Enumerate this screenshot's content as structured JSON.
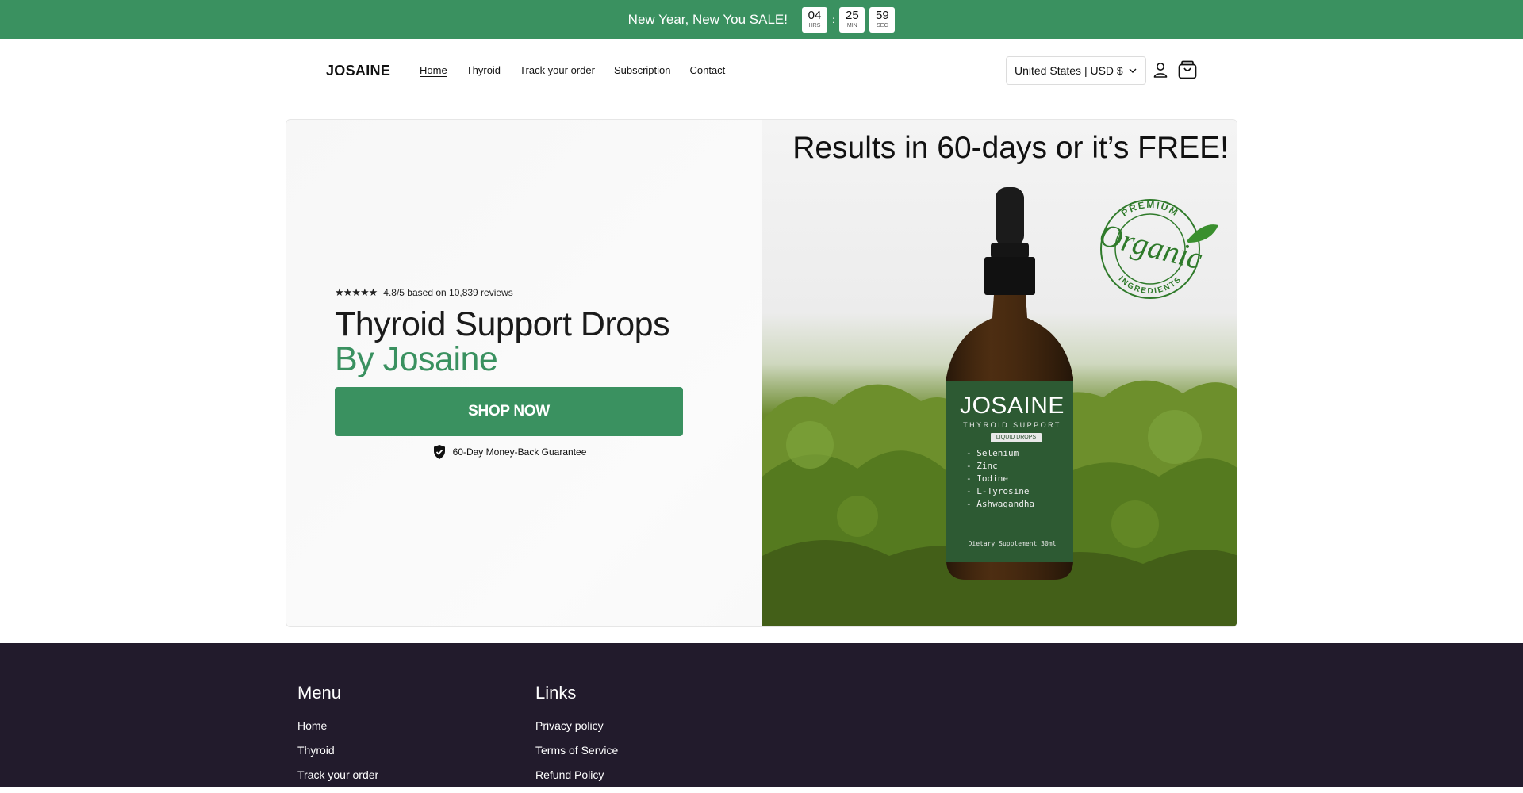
{
  "announcement": {
    "text": "New Year, New You SALE!",
    "countdown": [
      {
        "value": "04",
        "label": "HRS"
      },
      {
        "value": "25",
        "label": "MIN"
      },
      {
        "value": "59",
        "label": "SEC"
      }
    ],
    "separator": ":"
  },
  "header": {
    "logo": "JOSAINE",
    "nav": [
      "Home",
      "Thyroid",
      "Track your order",
      "Subscription",
      "Contact"
    ],
    "active_nav": "Home",
    "country_selector": "United States | USD $",
    "icons": {
      "account": "user-icon",
      "cart": "shopping-bag-icon",
      "dropdown": "chevron-down-icon"
    }
  },
  "hero": {
    "stars": "★★★★★",
    "rating_text": "4.8/5 based on 10,839 reviews",
    "title_line1": "Thyroid Support Drops",
    "title_line2": "By Josaine",
    "cta": "SHOP NOW",
    "guarantee": "60-Day Money-Back Guarantee",
    "headline": "Results in 60-days or it’s FREE!",
    "badge": {
      "top": "PREMIUM",
      "main": "Organic",
      "bottom": "INGREDIENTS"
    },
    "bottle": {
      "brand": "JOSAINE",
      "subtitle": "THYROID SUPPORT",
      "tag": "LIQUID DROPS",
      "ingredients": [
        "- Selenium",
        "- Zinc",
        "- Iodine",
        "- L-Tyrosine",
        "- Ashwagandha"
      ],
      "footer": "Dietary Supplement 30ml"
    }
  },
  "footer": {
    "menu_title": "Menu",
    "menu_items": [
      "Home",
      "Thyroid",
      "Track your order"
    ],
    "links_title": "Links",
    "links_items": [
      "Privacy policy",
      "Terms of Service",
      "Refund Policy"
    ]
  },
  "colors": {
    "brand_green": "#3a9160",
    "footer_bg": "#221b2c"
  }
}
